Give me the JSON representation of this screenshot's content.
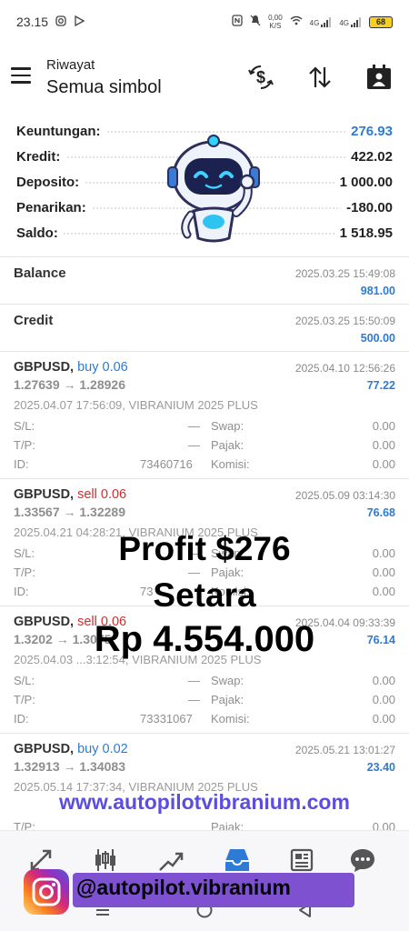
{
  "status_bar": {
    "time": "23.15",
    "net_speed_top": "0,00",
    "net_speed_unit": "K/S",
    "signal1": "4G",
    "signal2": "4G",
    "battery": "68"
  },
  "header": {
    "subtitle": "Riwayat",
    "title": "Semua simbol"
  },
  "summary": [
    {
      "label": "Keuntungan:",
      "value": "276.93",
      "color": "#2d7bd6"
    },
    {
      "label": "Kredit:",
      "value": "422.02"
    },
    {
      "label": "Deposito:",
      "value": "1 000.00"
    },
    {
      "label": "Penarikan:",
      "value": "-180.00"
    },
    {
      "label": "Saldo:",
      "value": "1 518.95"
    }
  ],
  "entries": [
    {
      "title": "Balance",
      "date": "2025.03.25 15:49:08",
      "amount": "981.00"
    },
    {
      "title": "Credit",
      "date": "2025.03.25 15:50:09",
      "amount": "500.00"
    }
  ],
  "trades": [
    {
      "symbol": "GBPUSD,",
      "side": "buy 0.06",
      "side_type": "buy",
      "price": "1.27639 → 1.28926",
      "date": "2025.04.10 12:56:26",
      "profit": "77.22",
      "open_info": "2025.04.07 17:56:09, VIBRANIUM 2025 PLUS",
      "sl_label": "S/L:",
      "sl": "—",
      "swap_label": "Swap:",
      "swap": "0.00",
      "tp_label": "T/P:",
      "tp": "—",
      "tax_label": "Pajak:",
      "tax": "0.00",
      "id_label": "ID:",
      "id": "73460716",
      "comm_label": "Komisi:",
      "comm": "0.00"
    },
    {
      "symbol": "GBPUSD,",
      "side": "sell 0.06",
      "side_type": "sell",
      "price": "1.33567 → 1.32289",
      "date": "2025.05.09 03:14:30",
      "profit": "76.68",
      "open_info": "2025.04.21 04:28:21, VIBRANIUM 2025 PLUS",
      "sl_label": "S/L:",
      "sl": "—",
      "swap_label": "Swap:",
      "swap": "0.00",
      "tp_label": "T/P:",
      "tp": "—",
      "tax_label": "Pajak:",
      "tax": "0.00",
      "id_label": "ID:",
      "id": "73",
      "comm_label": "Komisi:",
      "comm": "0.00"
    },
    {
      "symbol": "GBPUSD,",
      "side": "sell 0.06",
      "side_type": "sell",
      "price": "1.3202 → 1.3075",
      "date": "2025.04.04 09:33:39",
      "profit": "76.14",
      "open_info": "2025.04.03 ...3:12:54, VIBRANIUM 2025 PLUS",
      "sl_label": "S/L:",
      "sl": "—",
      "swap_label": "Swap:",
      "swap": "0.00",
      "tp_label": "T/P:",
      "tp": "—",
      "tax_label": "Pajak:",
      "tax": "0.00",
      "id_label": "ID:",
      "id": "73331067",
      "comm_label": "Komisi:",
      "comm": "0.00"
    },
    {
      "symbol": "GBPUSD,",
      "side": "buy 0.02",
      "side_type": "buy",
      "price": "1.32913 → 1.34083",
      "date": "2025.05.21 13:01:27",
      "profit": "23.40",
      "open_info": "2025.05.14 17:37:34, VIBRANIUM 2025 PLUS",
      "tp_label": "T/P:",
      "tax_label": "Pajak:",
      "tax": "0.00"
    }
  ],
  "overlay": {
    "line1": "Profit $276",
    "line2": "Setara",
    "line3": "Rp 4.554.000",
    "url": "www.autopilotvibranium.com",
    "instagram": "@autopilot.vibranium"
  },
  "colors": {
    "accent_blue": "#2d7bd6",
    "sell_red": "#d62d2d",
    "url_purple": "#5b4de0"
  },
  "icons": {
    "header": [
      "currency-exchange-icon",
      "sort-icon",
      "calendar-user-icon"
    ],
    "bottom_nav": [
      "quotes-icon",
      "chart-icon",
      "trade-icon",
      "history-icon",
      "news-icon",
      "chat-icon"
    ]
  }
}
